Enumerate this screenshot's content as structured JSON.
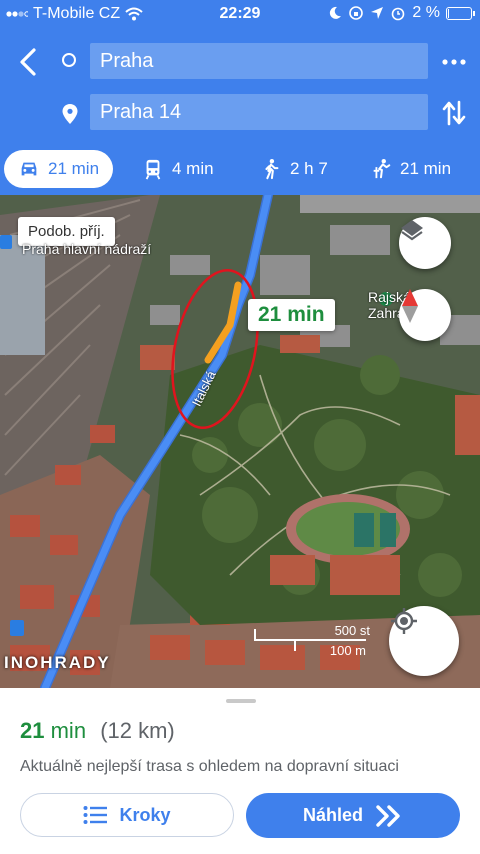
{
  "status_bar": {
    "carrier": "T-Mobile CZ",
    "time": "22:29",
    "battery": "2 %",
    "battery_level": 0.02
  },
  "header": {
    "origin": "Praha",
    "destination": "Praha 14"
  },
  "modes": [
    {
      "icon": "car-icon",
      "label": "21 min",
      "active": true
    },
    {
      "icon": "transit-icon",
      "label": "4 min",
      "active": false
    },
    {
      "icon": "walking-icon",
      "label": "2 h 7",
      "active": false
    },
    {
      "icon": "ride-share-icon",
      "label": "21 min",
      "active": false
    }
  ],
  "map": {
    "similar_places_chip": "Podob. příj.",
    "poi_station": "Praha hlavní nádraží",
    "poi_park": "Rajská Zahrada",
    "street": "Italská",
    "eta_bubble": "21 min",
    "district": "INOHRADY",
    "scale_top": "500 st",
    "scale_bottom": "100 m"
  },
  "sheet": {
    "duration_value": "21",
    "duration_unit": "min",
    "distance": "(12 km)",
    "description": "Aktuálně nejlepší trasa s ohledem na dopravní situaci",
    "steps_button": "Kroky",
    "preview_button": "Náhled"
  },
  "colors": {
    "brand_blue": "#3f80ec",
    "eta_green": "#1e8e3e",
    "route_blue": "#4a8df5",
    "traffic_orange": "#f4a020",
    "highlight_red": "#e0141e"
  }
}
